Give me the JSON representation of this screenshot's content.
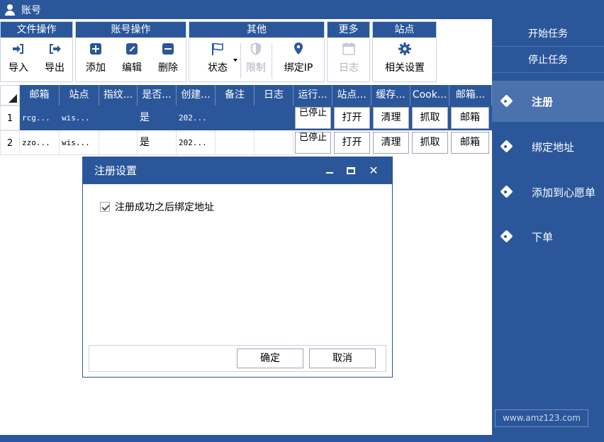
{
  "window": {
    "title": "账号"
  },
  "ribbon": {
    "groups": [
      {
        "label": "文件操作",
        "buttons": [
          "导入",
          "导出"
        ]
      },
      {
        "label": "账号操作",
        "buttons": [
          "添加",
          "编辑",
          "删除"
        ]
      },
      {
        "label": "其他",
        "buttons": [
          "状态",
          "限制",
          "绑定IP"
        ]
      },
      {
        "label": "更多",
        "buttons": [
          "日志"
        ]
      },
      {
        "label": "站点",
        "buttons": [
          "相关设置"
        ]
      }
    ]
  },
  "grid": {
    "columns": [
      "邮箱",
      "站点",
      "指纹...",
      "是否...",
      "创建...",
      "备注",
      "日志",
      "运行...",
      "站点...",
      "缓存...",
      "Cook...",
      "邮箱..."
    ],
    "rows": [
      {
        "num": "1",
        "email": "rcg...",
        "site": "wis...",
        "fp": "",
        "flag": "是",
        "created": "202...",
        "note": "",
        "log": "",
        "run": "已停止",
        "open": "打开",
        "clear": "清理",
        "grab": "抓取",
        "mailbox": "邮箱"
      },
      {
        "num": "2",
        "email": "zzo...",
        "site": "wis...",
        "fp": "",
        "flag": "是",
        "created": "202...",
        "note": "",
        "log": "",
        "run": "已停止",
        "open": "打开",
        "clear": "清理",
        "grab": "抓取",
        "mailbox": "邮箱"
      }
    ]
  },
  "side": {
    "start_task": "开始任务",
    "stop_task": "停止任务",
    "nav": [
      "注册",
      "绑定地址",
      "添加到心愿单",
      "下单"
    ],
    "watermark": "www.amz123.com"
  },
  "dialog": {
    "title": "注册设置",
    "checkbox_label": "注册成功之后绑定地址",
    "checkbox_checked": true,
    "ok": "确定",
    "cancel": "取消"
  },
  "colors": {
    "accent": "#2b579a",
    "accent_light": "#4a72ad"
  }
}
